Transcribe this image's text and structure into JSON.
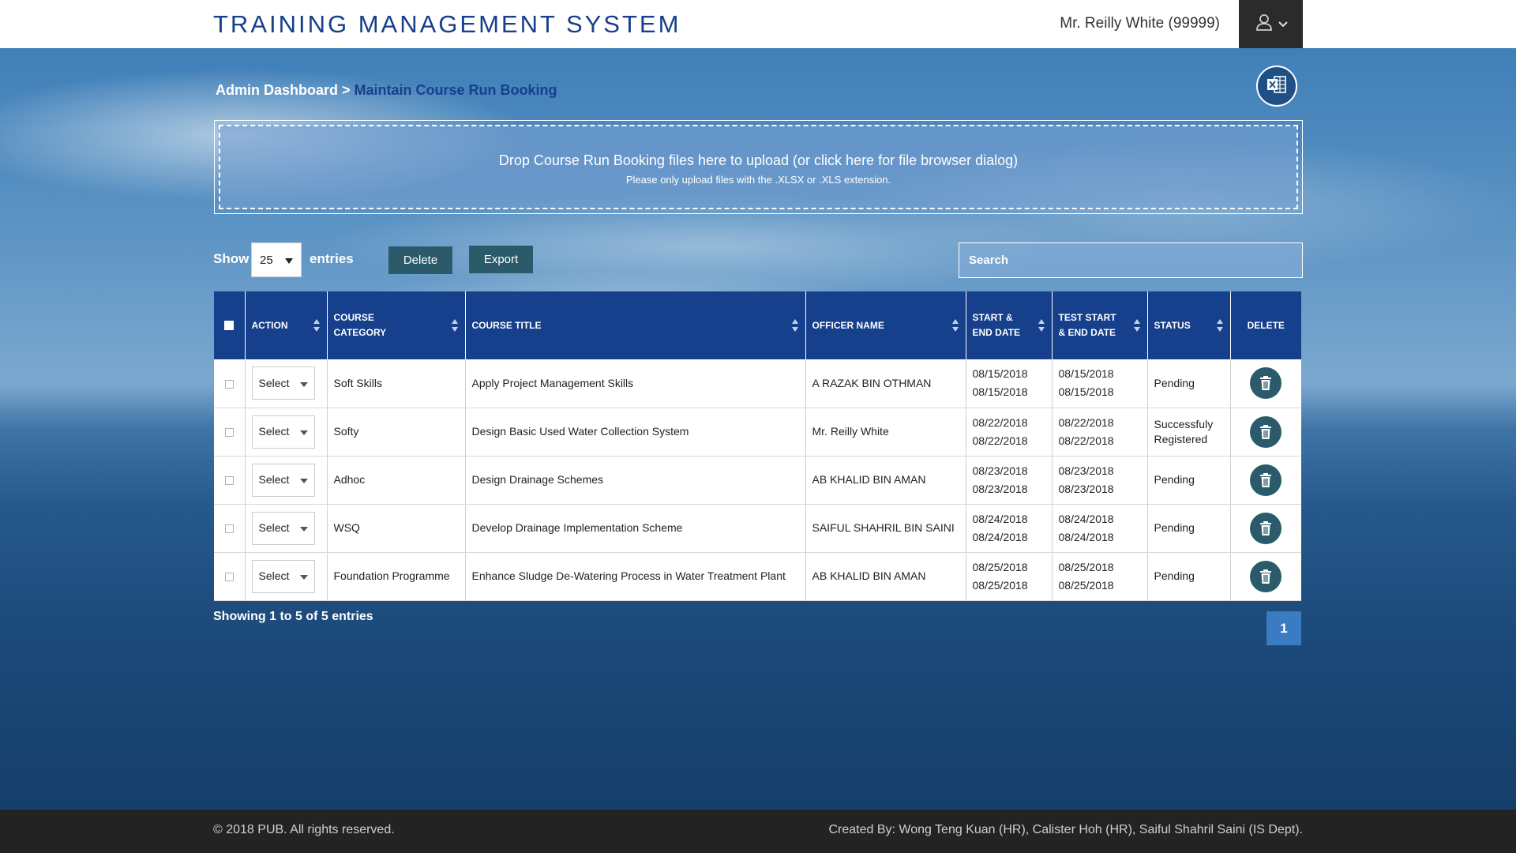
{
  "header": {
    "title": "TRAINING MANAGEMENT SYSTEM",
    "user": "Mr. Reilly White (99999)",
    "user_icon": "user-icon"
  },
  "breadcrumb": {
    "root": "Admin Dashboard",
    "separator": ">",
    "current": "Maintain Course Run Booking"
  },
  "excel_icon": "excel-icon",
  "dropzone": {
    "message": "Drop Course Run Booking files here to upload (or click here for file browser dialog)",
    "note": "Please only upload files with the .XLSX or .XLS extension."
  },
  "controls": {
    "show_label": "Show",
    "entries_value": "25",
    "entries_label": "entries",
    "delete_label": "Delete",
    "export_label": "Export",
    "search_placeholder": "Search"
  },
  "table": {
    "headers": {
      "action": "ACTION",
      "category_line1": "COURSE",
      "category_line2": "CATEGORY",
      "title": "COURSE TITLE",
      "officer": "OFFICER NAME",
      "dates_line1": "START &",
      "dates_line2": "END DATE",
      "test_line1": "TEST START",
      "test_line2": "& END DATE",
      "status": "STATUS",
      "delete": "DELETE"
    },
    "rows": [
      {
        "action": "Select",
        "category": "Soft Skills",
        "title": "Apply Project Management Skills",
        "officer": "A RAZAK BIN OTHMAN",
        "start": "08/15/2018",
        "end": "08/15/2018",
        "test_start": "08/15/2018",
        "test_end": "08/15/2018",
        "status": "Pending"
      },
      {
        "action": "Select",
        "category": "Softy",
        "title": "Design Basic Used Water Collection System",
        "officer": "Mr. Reilly White",
        "start": "08/22/2018",
        "end": "08/22/2018",
        "test_start": "08/22/2018",
        "test_end": "08/22/2018",
        "status": "Successfuly Registered"
      },
      {
        "action": "Select",
        "category": "Adhoc",
        "title": "Design Drainage Schemes",
        "officer": "AB KHALID BIN AMAN",
        "start": "08/23/2018",
        "end": "08/23/2018",
        "test_start": "08/23/2018",
        "test_end": "08/23/2018",
        "status": "Pending"
      },
      {
        "action": "Select",
        "category": "WSQ",
        "title": "Develop Drainage Implementation Scheme",
        "officer": "SAIFUL SHAHRIL BIN SAINI",
        "start": "08/24/2018",
        "end": "08/24/2018",
        "test_start": "08/24/2018",
        "test_end": "08/24/2018",
        "status": "Pending"
      },
      {
        "action": "Select",
        "category": "Foundation Programme",
        "title": "Enhance Sludge De-Watering Process in Water Treatment Plant",
        "officer": "AB KHALID BIN AMAN",
        "start": "08/25/2018",
        "end": "08/25/2018",
        "test_start": "08/25/2018",
        "test_end": "08/25/2018",
        "status": "Pending"
      }
    ]
  },
  "pagination": {
    "info": "Showing 1 to 5 of 5 entries",
    "current_page": "1"
  },
  "footer": {
    "copyright": "© 2018 PUB. All rights reserved.",
    "credits": "Created By: Wong Teng Kuan (HR), Calister Hoh (HR), Saiful Shahril Saini (IS Dept)."
  },
  "colors": {
    "brand_navy": "#163f8c",
    "header_bg": "#ffffff",
    "footer_bg": "#232323",
    "action_teal": "#2b5a6a",
    "page_active": "#3a7cc1"
  }
}
